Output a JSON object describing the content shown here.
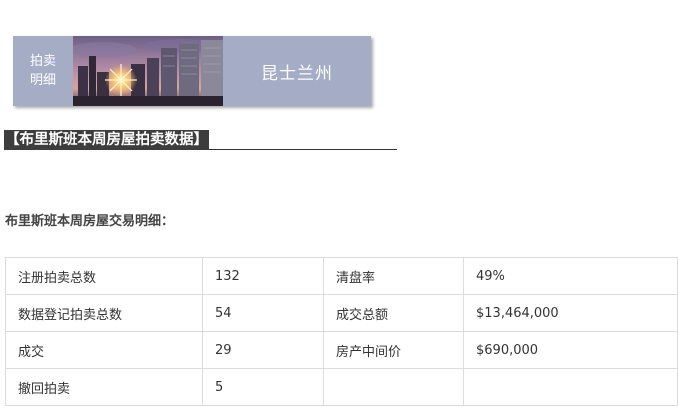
{
  "banner": {
    "side_line1": "拍卖",
    "side_line2": "明细",
    "city": "昆士兰州"
  },
  "section_title": "【布里斯班本周房屋拍卖数据】",
  "subtitle": "布里斯班本周房屋交易明细：",
  "table": {
    "rows": [
      [
        "注册拍卖总数",
        "132",
        "清盘率",
        "49%"
      ],
      [
        "数据登记拍卖总数",
        "54",
        "成交总额",
        "$13,464,000"
      ],
      [
        "成交",
        "29",
        "房产中间价",
        "$690,000"
      ],
      [
        "撤回拍卖",
        "5",
        "",
        ""
      ]
    ]
  }
}
